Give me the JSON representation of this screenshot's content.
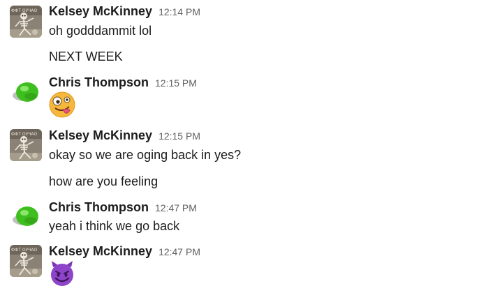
{
  "messages": [
    {
      "author": "Kelsey McKinney",
      "time": "12:14 PM",
      "avatar": "skeleton-avatar",
      "lines": [
        "oh godddammit lol",
        "NEXT WEEK"
      ]
    },
    {
      "author": "Chris Thompson",
      "time": "12:15 PM",
      "avatar": "lime-avatar",
      "emoji": "zany-face-emoji"
    },
    {
      "author": "Kelsey McKinney",
      "time": "12:15 PM",
      "avatar": "skeleton-avatar",
      "lines": [
        "okay so we are oging back in yes?",
        "how are you feeling"
      ]
    },
    {
      "author": "Chris Thompson",
      "time": "12:47 PM",
      "avatar": "lime-avatar",
      "lines": [
        "yeah i think we go back"
      ]
    },
    {
      "author": "Kelsey McKinney",
      "time": "12:47 PM",
      "avatar": "skeleton-avatar",
      "emoji": "smiling-devil-emoji"
    }
  ],
  "colors": {
    "text": "#1d1c1d",
    "timestamp": "#616061",
    "lime": "#3fbf1f",
    "devil_purple": "#8e44c9",
    "zany_yellow": "#f5b83c"
  }
}
